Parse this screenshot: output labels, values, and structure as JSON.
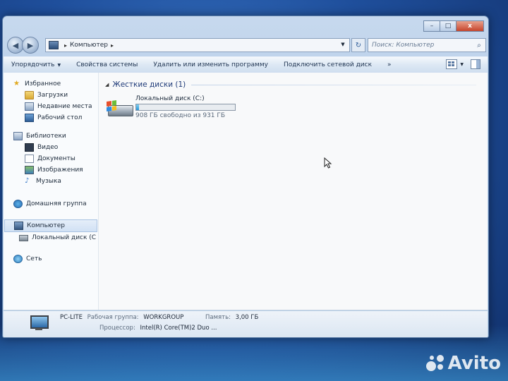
{
  "window": {
    "breadcrumb": {
      "root": "Компьютер"
    },
    "search": {
      "placeholder": "Поиск: Компьютер"
    },
    "title_buttons": {
      "minimize": "–",
      "maximize": "□",
      "close": "x"
    }
  },
  "toolbar": {
    "organize": "Упорядочить",
    "system_properties": "Свойства системы",
    "uninstall": "Удалить или изменить программу",
    "map_drive": "Подключить сетевой диск",
    "more": "»"
  },
  "sidebar": {
    "favorites": {
      "label": "Избранное",
      "items": [
        "Загрузки",
        "Недавние места",
        "Рабочий стол"
      ]
    },
    "libraries": {
      "label": "Библиотеки",
      "items": [
        "Видео",
        "Документы",
        "Изображения",
        "Музыка"
      ]
    },
    "homegroup": "Домашняя группа",
    "computer": {
      "label": "Компьютер",
      "items": [
        "Локальный диск (C"
      ]
    },
    "network": "Сеть"
  },
  "main": {
    "group_header": "Жесткие диски (1)",
    "drive": {
      "name": "Локальный диск (C:)",
      "free_text": "908 ГБ свободно из 931 ГБ",
      "used_fraction": 0.025
    }
  },
  "status": {
    "computer_name": "PC-LITE",
    "workgroup_label": "Рабочая группа:",
    "workgroup_value": "WORKGROUP",
    "memory_label": "Память:",
    "memory_value": "3,00 ГБ",
    "cpu_label": "Процессор:",
    "cpu_value": "Intel(R) Core(TM)2 Duo ..."
  },
  "watermark": {
    "text": "Avito"
  },
  "colors": {
    "accent": "#1e3a78",
    "bar_fill": "#2796d6",
    "desktop": "#1f4f9c"
  }
}
